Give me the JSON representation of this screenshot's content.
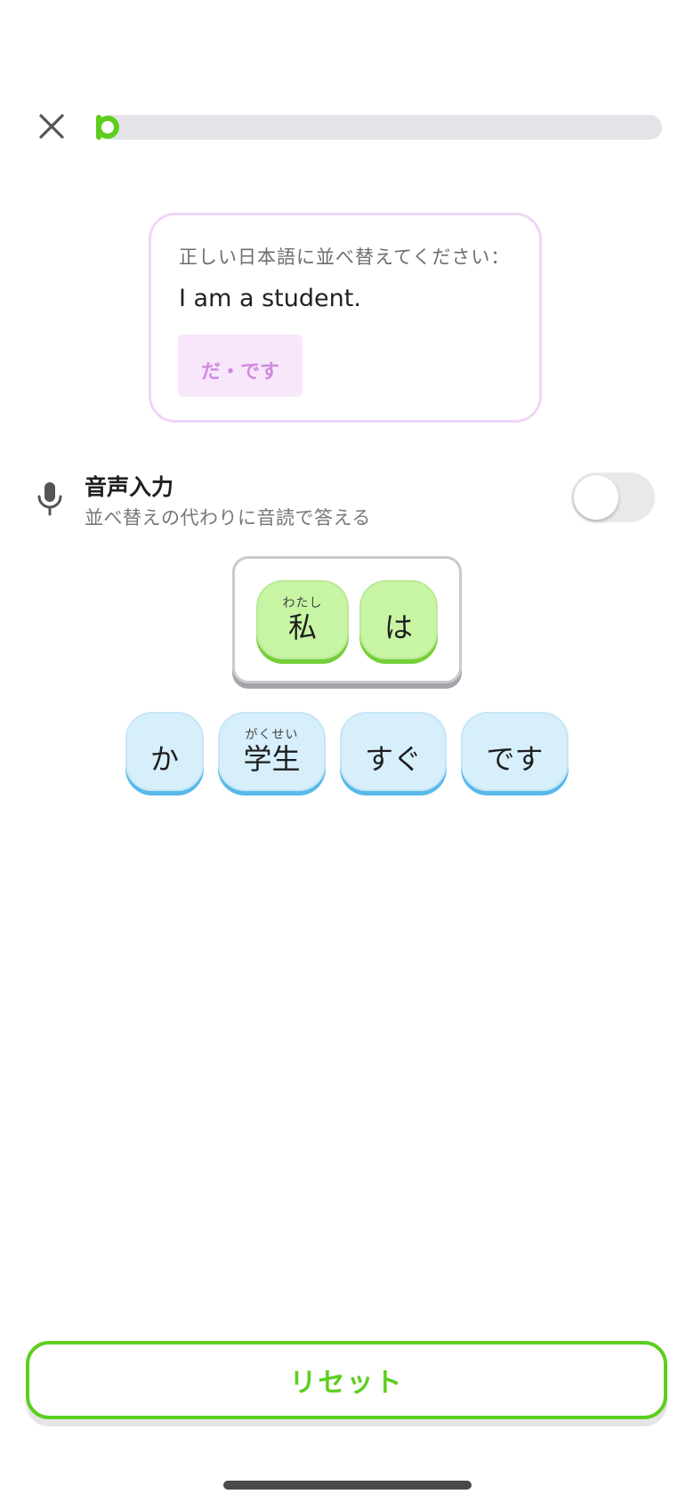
{
  "header": {
    "close_icon": "close-icon",
    "progress": 0.0
  },
  "prompt": {
    "instruction": "正しい日本語に並べ替えてください：",
    "sentence": "I am a student.",
    "register_label": "だ・です"
  },
  "voice_input": {
    "icon": "microphone-icon",
    "title": "音声入力",
    "subtitle": "並べ替えの代わりに音読で答える",
    "enabled": false
  },
  "answer_tiles": [
    {
      "text": "私",
      "furigana": "わたし"
    },
    {
      "text": "は",
      "furigana": ""
    }
  ],
  "word_bank": [
    {
      "text": "か",
      "furigana": ""
    },
    {
      "text": "学生",
      "furigana": "がくせい"
    },
    {
      "text": "すぐ",
      "furigana": ""
    },
    {
      "text": "です",
      "furigana": ""
    }
  ],
  "reset_label": "リセット",
  "colors": {
    "accent_green": "#5ccf1e",
    "answer_tile": "#c7f5a3",
    "bank_tile": "#d7effb",
    "prompt_border": "#efd5f7",
    "register_text": "#cf8be0"
  }
}
